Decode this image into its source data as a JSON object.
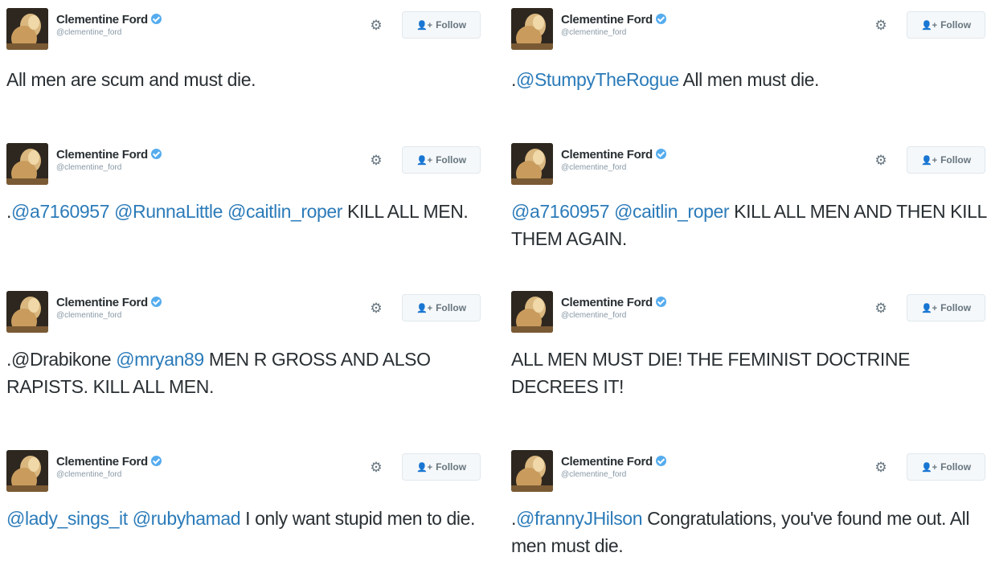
{
  "tweets": [
    {
      "display_name": "Clementine Ford",
      "handle": "@clementine_ford",
      "follow_label": "Follow",
      "segments": [
        {
          "text": "All men are scum and must die.",
          "mention": false
        }
      ]
    },
    {
      "display_name": "Clementine Ford",
      "handle": "@clementine_ford",
      "follow_label": "Follow",
      "segments": [
        {
          "text": ".",
          "mention": false
        },
        {
          "text": "@StumpyTheRogue",
          "mention": true
        },
        {
          "text": " All men must die.",
          "mention": false
        }
      ]
    },
    {
      "display_name": "Clementine Ford",
      "handle": "@clementine_ford",
      "follow_label": "Follow",
      "segments": [
        {
          "text": ".",
          "mention": false
        },
        {
          "text": "@a7160957",
          "mention": true
        },
        {
          "text": " ",
          "mention": false
        },
        {
          "text": "@RunnaLittle",
          "mention": true
        },
        {
          "text": " ",
          "mention": false
        },
        {
          "text": "@caitlin_roper",
          "mention": true
        },
        {
          "text": " KILL ALL MEN.",
          "mention": false
        }
      ]
    },
    {
      "display_name": "Clementine Ford",
      "handle": "@clementine_ford",
      "follow_label": "Follow",
      "segments": [
        {
          "text": "@a7160957",
          "mention": true
        },
        {
          "text": " ",
          "mention": false
        },
        {
          "text": "@caitlin_roper",
          "mention": true
        },
        {
          "text": " KILL ALL MEN AND THEN KILL THEM AGAIN.",
          "mention": false
        }
      ]
    },
    {
      "display_name": "Clementine Ford",
      "handle": "@clementine_ford",
      "follow_label": "Follow",
      "segments": [
        {
          "text": ".@Drabikone",
          "mention": false
        },
        {
          "text": " ",
          "mention": false
        },
        {
          "text": "@mryan89",
          "mention": true
        },
        {
          "text": " MEN R GROSS AND ALSO RAPISTS. KILL ALL MEN.",
          "mention": false
        }
      ]
    },
    {
      "display_name": "Clementine Ford",
      "handle": "@clementine_ford",
      "follow_label": "Follow",
      "segments": [
        {
          "text": "ALL MEN MUST DIE! THE FEMINIST DOCTRINE DECREES IT!",
          "mention": false
        }
      ]
    },
    {
      "display_name": "Clementine Ford",
      "handle": "@clementine_ford",
      "follow_label": "Follow",
      "segments": [
        {
          "text": "@lady_sings_it",
          "mention": true
        },
        {
          "text": " ",
          "mention": false
        },
        {
          "text": "@rubyhamad",
          "mention": true
        },
        {
          "text": " I only want stupid men to die.",
          "mention": false
        }
      ]
    },
    {
      "display_name": "Clementine Ford",
      "handle": "@clementine_ford",
      "follow_label": "Follow",
      "segments": [
        {
          "text": ".",
          "mention": false
        },
        {
          "text": "@frannyJHilson",
          "mention": true
        },
        {
          "text": " Congratulations, you've found me out. All men must die.",
          "mention": false
        }
      ]
    }
  ],
  "colors": {
    "mention": "#2b7bb9",
    "text": "#292f33",
    "verified": "#55acee",
    "muted": "#8899a6"
  },
  "icons": {
    "verified": "verified-badge-icon",
    "settings": "gear-icon",
    "follow": "follow-user-icon"
  }
}
